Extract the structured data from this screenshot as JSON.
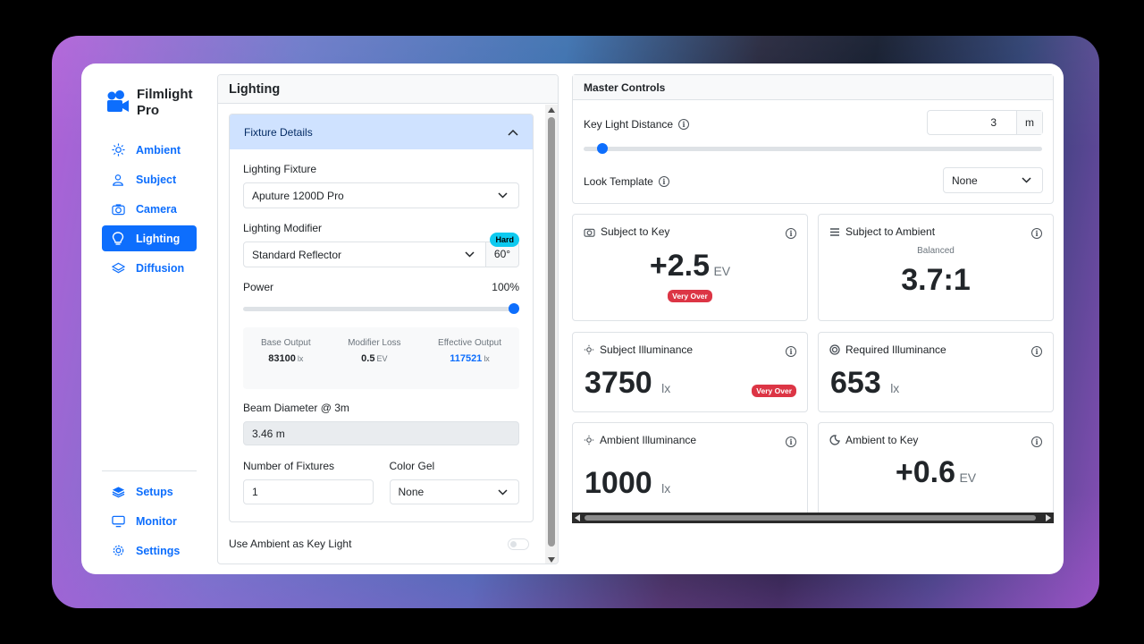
{
  "brand": {
    "name": "Filmlight Pro"
  },
  "nav": {
    "items": [
      {
        "label": "Ambient",
        "icon": "sun-icon"
      },
      {
        "label": "Subject",
        "icon": "person-icon"
      },
      {
        "label": "Camera",
        "icon": "camera-icon"
      },
      {
        "label": "Lighting",
        "icon": "lightbulb-icon",
        "active": true
      },
      {
        "label": "Diffusion",
        "icon": "layers-icon"
      }
    ],
    "bottom": [
      {
        "label": "Setups",
        "icon": "stack-icon"
      },
      {
        "label": "Monitor",
        "icon": "monitor-icon"
      },
      {
        "label": "Settings",
        "icon": "gear-icon"
      }
    ]
  },
  "lighting": {
    "title": "Lighting",
    "accordion_title": "Fixture Details",
    "fixture_label": "Lighting Fixture",
    "fixture_value": "Aputure 1200D Pro",
    "modifier_label": "Lighting Modifier",
    "modifier_badge": "Hard",
    "modifier_value": "Standard Reflector",
    "modifier_angle": "60°",
    "power_label": "Power",
    "power_value": "100%",
    "power_fraction": 1.0,
    "stats": {
      "base_label": "Base Output",
      "base_value": "83100",
      "base_unit": "lx",
      "loss_label": "Modifier Loss",
      "loss_value": "0.5",
      "loss_unit": "EV",
      "effective_label": "Effective Output",
      "effective_value": "117521",
      "effective_unit": "lx"
    },
    "beam_label": "Beam Diameter @ 3m",
    "beam_value": "3.46 m",
    "fixtures_label": "Number of Fixtures",
    "fixtures_value": "1",
    "gel_label": "Color Gel",
    "gel_value": "None",
    "ambient_key_label": "Use Ambient as Key Light"
  },
  "master": {
    "title": "Master Controls",
    "key_distance_label": "Key Light Distance",
    "key_distance_value": "3",
    "key_distance_unit": "m",
    "key_distance_fraction": 0.03,
    "look_label": "Look Template",
    "look_value": "None"
  },
  "cards": {
    "subject_to_key": {
      "title": "Subject to Key",
      "value": "+2.5",
      "unit": "EV",
      "badge": "Very Over"
    },
    "subject_to_ambient": {
      "title": "Subject to Ambient",
      "caption": "Balanced",
      "value": "3.7:1"
    },
    "subject_illuminance": {
      "title": "Subject Illuminance",
      "value": "3750",
      "unit": "lx",
      "badge": "Very Over"
    },
    "required_illuminance": {
      "title": "Required Illuminance",
      "value": "653",
      "unit": "lx"
    },
    "ambient_illuminance": {
      "title": "Ambient Illuminance",
      "value": "1000",
      "unit": "lx"
    },
    "ambient_to_key": {
      "title": "Ambient to Key",
      "value": "+0.6",
      "unit": "EV"
    }
  },
  "colors": {
    "accent": "#0d6efd",
    "danger": "#dc3545",
    "info": "#0dcaf0"
  }
}
